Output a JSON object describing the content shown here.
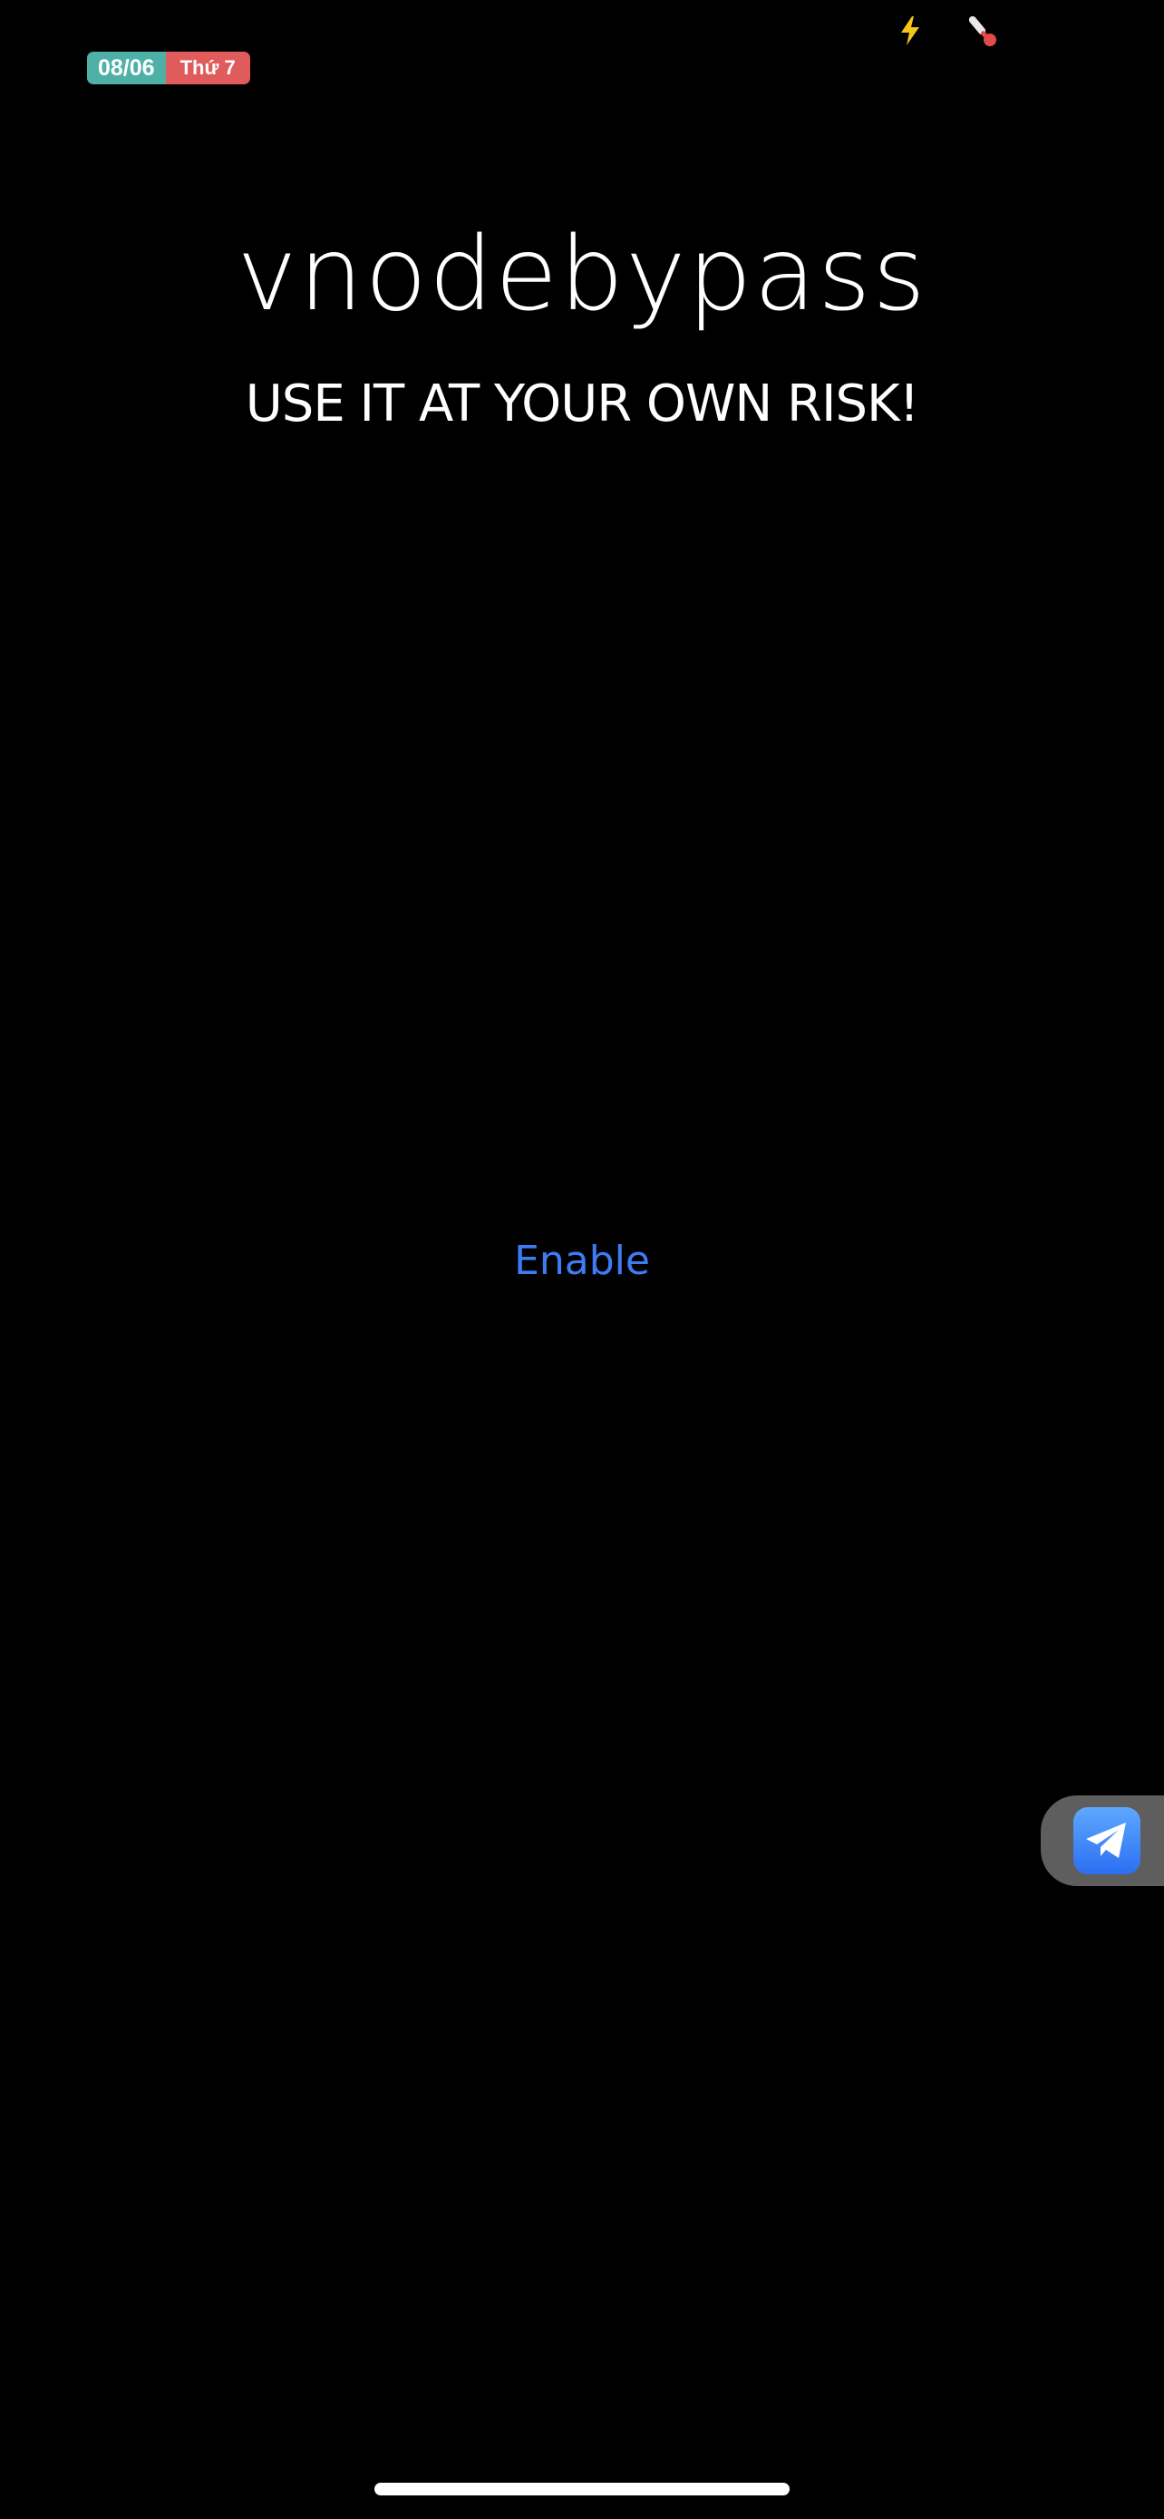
{
  "status_bar": {
    "date": "08/06",
    "weekday": "Thứ 7",
    "icons": [
      "bolt-icon",
      "thermometer-icon"
    ]
  },
  "app": {
    "title": "vnodebypass",
    "warning": "USE IT AT YOUR OWN RISK!",
    "enable_label": "Enable"
  },
  "floating_button": {
    "icon": "telegram-icon"
  },
  "colors": {
    "background": "#000000",
    "text": "#ffffff",
    "accent": "#3e7bf5",
    "date_badge": "#4fb0a7",
    "weekday_badge": "#e05b5b",
    "floating_panel": "#5e5e5e"
  }
}
